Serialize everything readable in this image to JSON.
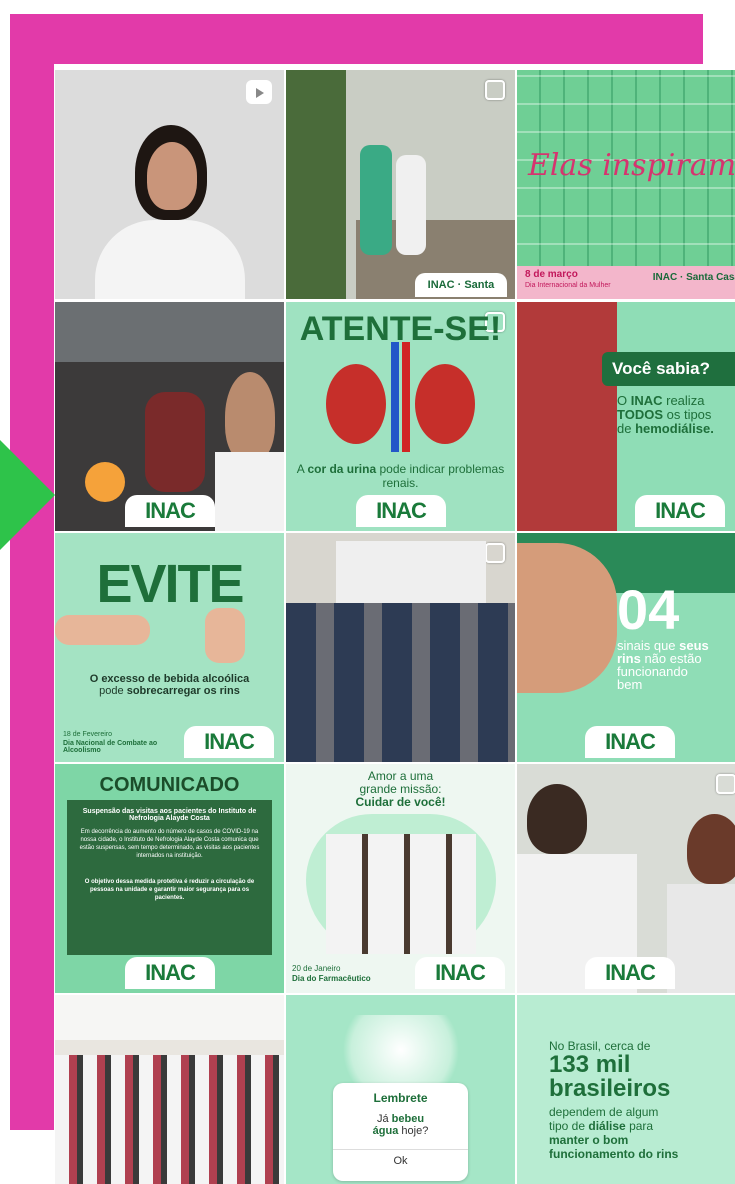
{
  "tiles": {
    "t2": {
      "script": "Elas inspiram",
      "date": "8 de março",
      "subtitle": "Dia Internacional da Mulher",
      "logo": "INAC",
      "logo2": "Santa Casa"
    },
    "t1": {
      "logo": "INAC",
      "logo2": "Santa Casa"
    },
    "t3": {
      "logo": "INAC"
    },
    "t4": {
      "title": "ATENTE-SE!",
      "text_a": "A ",
      "text_b": "cor da urina",
      "text_c": " pode indicar problemas renais.",
      "logo": "INAC"
    },
    "t5": {
      "title": "Você sabia?",
      "l1a": "O ",
      "l1b": "INAC",
      "l1c": " realiza",
      "l2a": "TODOS",
      "l2b": " os tipos",
      "l3a": "de ",
      "l3b": "hemodiálise.",
      "logo": "INAC"
    },
    "t6": {
      "title": "EVITE",
      "l1": "O excesso de bebida alcoólica",
      "l2a": "pode ",
      "l2b": "sobrecarregar os rins",
      "date": "18 de Fevereiro",
      "caption": "Dia Nacional de Combate ao Alcoolismo",
      "logo": "INAC"
    },
    "t8": {
      "num": "04",
      "l1": "sinais que ",
      "l1b": "seus",
      "l2a": "rins",
      "l2b": " não estão",
      "l3": "funcionando",
      "l4": "bem",
      "logo": "INAC"
    },
    "t9": {
      "title": "COMUNICADO",
      "head": "Suspensão das visitas aos pacientes do Instituto de Nefrologia Alayde Costa",
      "body": "Em decorrência do aumento do número de casos de COVID-19 na nossa cidade, o Instituto de Nefrologia Alayde Costa comunica que estão suspensas, sem tempo determinado, as visitas aos pacientes internados na instituição.",
      "bold": "O objetivo dessa medida protetiva é reduzir a circulação de pessoas na unidade e garantir maior segurança para os pacientes.",
      "logo": "INAC"
    },
    "t10": {
      "l1": "Amor a uma",
      "l2": "grande missão:",
      "l3": "Cuidar de você!",
      "date": "20 de Janeiro",
      "caption": "Dia do Farmacêutico",
      "logo": "INAC"
    },
    "t11": {
      "logo": "INAC"
    },
    "t13": {
      "title": "Lembrete",
      "l1": "Já ",
      "l1b": "bebeu",
      "l2a": "água",
      "l2b": " hoje?",
      "ok": "Ok"
    },
    "t14": {
      "l1": "No Brasil, cerca de",
      "l2": "133 mil",
      "l3": "brasileiros",
      "l4": "dependem de algum",
      "l5a": "tipo de ",
      "l5b": "diálise",
      "l5c": " para",
      "l6": "manter o bom",
      "l7": "funcionamento do rins"
    }
  },
  "colors": {
    "magenta": "#e23aa9",
    "arrow": "#2ec34a",
    "brand_green": "#1a7a3a"
  }
}
